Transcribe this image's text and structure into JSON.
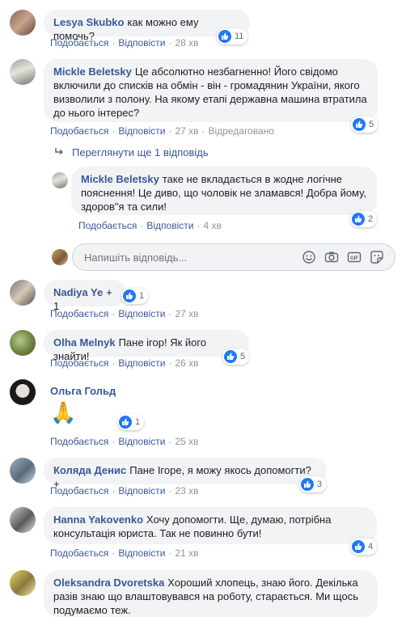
{
  "labels": {
    "like": "Подобається",
    "reply": "Відповісти",
    "edited": "Відредаговано",
    "reply_placeholder": "Напишіть відповідь...",
    "more_replies": "Переглянути ще 1 відповідь"
  },
  "colors": {
    "link": "#385898",
    "bubble": "#f2f3f5",
    "like_blue": "#2078f4",
    "meta": "#90949c"
  },
  "comments": [
    {
      "author": "Lesya Skubko",
      "text": "как можно ему помочь?",
      "time": "28 хв",
      "likes": "11"
    },
    {
      "author": "Mickle Beletsky",
      "text": "Це абсолютно незбагненно! Його свідомо включили до списків на обмін - він - громадянин України, якого визволили з полону. На якому етапі державна машина втратила до нього інтерес?",
      "time": "27 хв",
      "likes": "5"
    },
    {
      "author": "Mickle Beletsky",
      "text": "таке не вкладається в жодне логічне пояснення! Це диво, що чоловік не зламався! Добра йому, здоров\"я та сили!",
      "time": "4 хв",
      "likes": "2"
    },
    {
      "author": "Nadiya Ye",
      "text": "+ 1",
      "time": "27 хв",
      "likes": "1"
    },
    {
      "author": "Olha Melnyk",
      "text": "Пане ігор! Як його знайти!",
      "time": "26 хв",
      "likes": "5"
    },
    {
      "author": "Ольга Гольд",
      "text": "",
      "time": "25 хв",
      "likes": "1"
    },
    {
      "author": "Коляда Денис",
      "text": "Пане Ігоре, я можу якось допомогти? +",
      "time": "23 хв",
      "likes": "3"
    },
    {
      "author": "Hanna Yakovenko",
      "text": "Хочу допомогти. Ще, думаю, потрібна консультація юриста. Так не повинно бути!",
      "time": "21 хв",
      "likes": "4"
    },
    {
      "author": "Oleksandra Dvoretska",
      "text": "Хороший хлопець, знаю його. Декілька разів знаю що влаштовувався на роботу, старається. Ми щось подумаємо теж.",
      "time": "",
      "likes": ""
    }
  ],
  "icons": [
    "like-icon",
    "reply-arrow-icon",
    "emoji-icon",
    "camera-icon",
    "gif-icon",
    "sticker-icon",
    "pray-emoji"
  ]
}
